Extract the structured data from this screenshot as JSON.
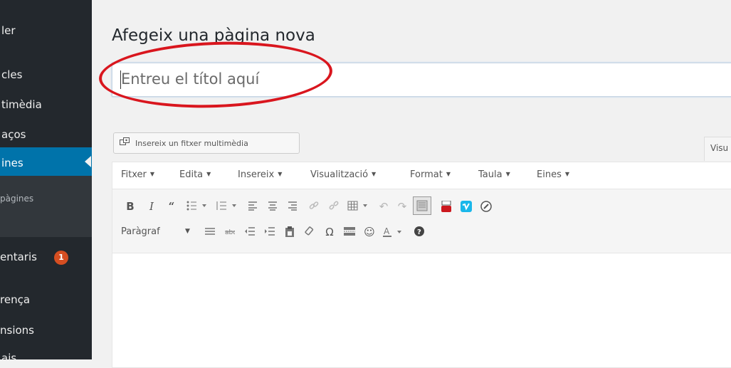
{
  "sidebar": {
    "items": [
      {
        "label": "ler"
      },
      {
        "label": "cles"
      },
      {
        "label": "timèdia"
      },
      {
        "label": "aços"
      },
      {
        "label": "ines"
      },
      {
        "label": "pàgines"
      },
      {
        "label": "entaris"
      },
      {
        "label": "rença"
      },
      {
        "label": "nsions"
      },
      {
        "label": "ais"
      }
    ],
    "comments_badge": "1",
    "active_color": "#0073aa"
  },
  "header": {
    "title": "Afegeix una pàgina nova"
  },
  "title_field": {
    "placeholder": "Entreu el títol aquí",
    "value": ""
  },
  "editor": {
    "media_button": "Insereix un fitxer multimèdia",
    "visual_tab": "Visu",
    "menu": [
      "Fitxer",
      "Edita",
      "Insereix",
      "Visualització",
      "Format",
      "Taula",
      "Eines"
    ],
    "format_select": "Paràgraf",
    "toolbar_row1": [
      "bold-icon",
      "italic-icon",
      "blockquote-icon",
      "bullet-list-icon",
      "numbered-list-icon",
      "align-left-icon",
      "align-center-icon",
      "align-right-icon",
      "link-icon",
      "unlink-icon",
      "table-icon",
      "undo-icon",
      "redo-icon",
      "fullscreen-icon",
      "youtube-icon",
      "vimeo-icon",
      "flash-icon"
    ],
    "toolbar_row2": [
      "horizontal-line-icon",
      "strikethrough-icon",
      "outdent-icon",
      "indent-icon",
      "paste-text-icon",
      "clear-formatting-icon",
      "special-char-icon",
      "more-tag-icon",
      "emoticon-icon",
      "text-color-icon",
      "help-icon"
    ]
  },
  "annotation": {
    "color": "#d9161e",
    "shape": "oval around title field"
  }
}
